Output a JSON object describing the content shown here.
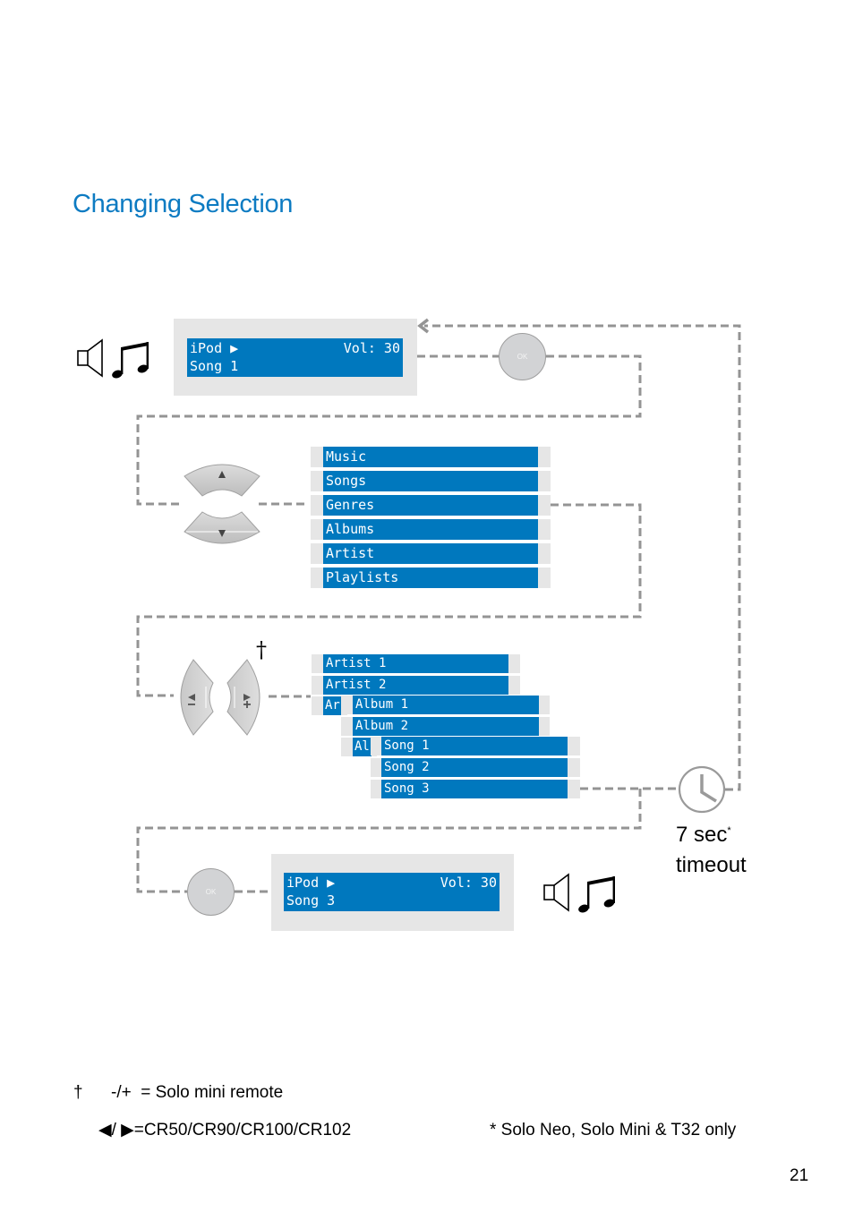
{
  "page": {
    "title": "Changing Selection",
    "page_number": "21",
    "accent_color": "#0d7bc2",
    "lcd_color": "#0078be"
  },
  "step1": {
    "icons": [
      "speaker-icon",
      "music-note-icon"
    ],
    "lcd_line1_left": "iPod ▶",
    "lcd_line1_right": "Vol: 30",
    "lcd_line2": "Song 1",
    "button_label": "OK"
  },
  "step2": {
    "control": "up-down-buttons",
    "up_symbol": "▲",
    "down_symbol": "▼",
    "menu_items": [
      "Music",
      "Songs",
      "Genres",
      "Albums",
      "Artist",
      "Playlists"
    ]
  },
  "step3": {
    "control": "left-right-buttons",
    "left_symbol": "◀",
    "left_sign": "−",
    "right_symbol": "▶",
    "right_sign": "+",
    "dagger": "†",
    "artists": [
      "Artist 1",
      "Artist 2",
      "Ar"
    ],
    "albums": [
      "Album 1",
      "Album 2",
      "Al"
    ],
    "songs": [
      "Song 1",
      "Song 2",
      "Song 3"
    ]
  },
  "timeout": {
    "icon": "clock-icon",
    "line1": "7 sec",
    "asterisk": "*",
    "line2": "timeout"
  },
  "step4": {
    "button_label": "OK",
    "lcd_line1_left": "iPod ▶",
    "lcd_line1_right": "Vol: 30",
    "lcd_line2": "Song 3",
    "icons": [
      "speaker-icon",
      "music-note-icon"
    ]
  },
  "footnotes": {
    "dagger": "†",
    "dagger_text": "-/+  = Solo mini remote",
    "arrows_text": "◀/ ▶=CR50/CR90/CR100/CR102",
    "asterisk_text": "* Solo Neo, Solo Mini & T32 only"
  }
}
